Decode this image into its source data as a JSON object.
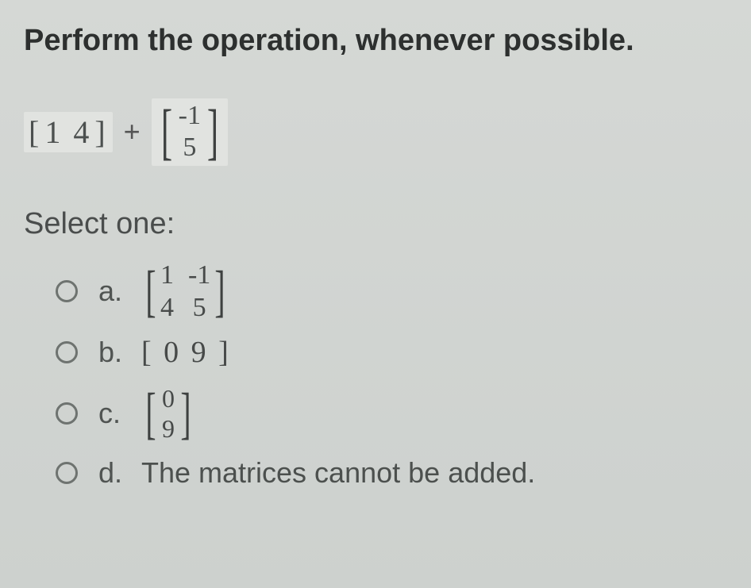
{
  "question": {
    "title": "Perform the operation, whenever possible.",
    "matrix1_left": "[",
    "matrix1_content": "1 4",
    "matrix1_right": "]",
    "operator": "+",
    "matrix2_top": "-1",
    "matrix2_bottom": "5"
  },
  "select_label": "Select one:",
  "options": {
    "a": {
      "letter": "a.",
      "m00": "1",
      "m01": "-1",
      "m10": "4",
      "m11": "5"
    },
    "b": {
      "letter": "b.",
      "content": "[ 0 9 ]"
    },
    "c": {
      "letter": "c.",
      "top": "0",
      "bottom": "9"
    },
    "d": {
      "letter": "d.",
      "text": "The matrices cannot be added."
    }
  }
}
